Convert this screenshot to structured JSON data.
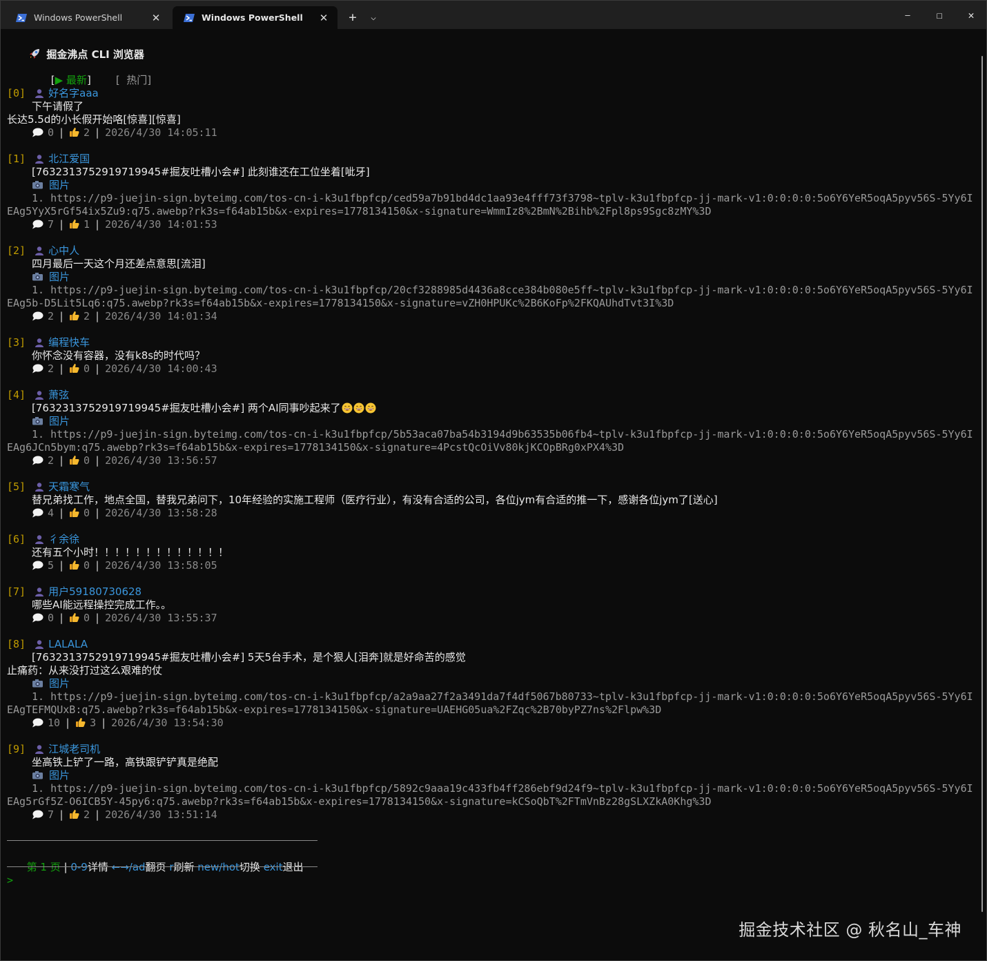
{
  "window": {
    "tabs": [
      {
        "label": "Windows PowerShell",
        "active": false
      },
      {
        "label": "Windows PowerShell",
        "active": true
      }
    ],
    "new_tab_glyph": "+",
    "dropdown_glyph": "⌵",
    "minimize_glyph": "—",
    "maximize_glyph": "☐",
    "close_glyph": "✕",
    "tab_close_glyph": "✕"
  },
  "app": {
    "title": "掘金沸点 CLI 浏览器",
    "tabs": {
      "latest_open": "[",
      "latest_arrow": "▶",
      "latest_label": "最新",
      "latest_close": "]",
      "hot_label": "[  热门]"
    }
  },
  "posts": [
    {
      "index": "[0]",
      "user": "好名字aaa",
      "content_lines": [
        {
          "text": "下午请假了",
          "indent": true
        },
        {
          "text": "长达5.5d的小长假开始咯[惊喜][惊喜]",
          "indent": false
        }
      ],
      "image_label": "",
      "url_lines": [],
      "comments": "0",
      "likes": "2",
      "time": "2026/4/30 14:05:11"
    },
    {
      "index": "[1]",
      "user": "北江爱国",
      "content_lines": [
        {
          "text": "[7632313752919719945#掘友吐槽小会#] 此刻谁还在工位坐着[呲牙]",
          "indent": true
        }
      ],
      "image_label": "图片",
      "url_lines": [
        "1. https://p9-juejin-sign.byteimg.com/tos-cn-i-k3u1fbpfcp/ced59a7b91bd4dc1aa93e4fff73f3798~tplv-k3u1fbpfcp-jj-mark-v1:0:0:0:0:5o6Y6YeR5oqA5pyv56S-5Yy6I",
        "EAg5YyX5rGf54ix5Zu9:q75.awebp?rk3s=f64ab15b&x-expires=1778134150&x-signature=WmmIz8%2BmN%2Bihb%2Fpl8ps9Sgc8zMY%3D"
      ],
      "comments": "7",
      "likes": "1",
      "time": "2026/4/30 14:01:53"
    },
    {
      "index": "[2]",
      "user": "心中人",
      "content_lines": [
        {
          "text": "四月最后一天这个月还差点意思[流泪]",
          "indent": true
        }
      ],
      "image_label": "图片",
      "url_lines": [
        "1. https://p9-juejin-sign.byteimg.com/tos-cn-i-k3u1fbpfcp/20cf3288985d4436a8cce384b080e5ff~tplv-k3u1fbpfcp-jj-mark-v1:0:0:0:0:5o6Y6YeR5oqA5pyv56S-5Yy6I",
        "EAg5b-D5Lit5Lq6:q75.awebp?rk3s=f64ab15b&x-expires=1778134150&x-signature=vZH0HPUKc%2B6KoFp%2FKQAUhdTvt3I%3D"
      ],
      "comments": "2",
      "likes": "2",
      "time": "2026/4/30 14:01:34"
    },
    {
      "index": "[3]",
      "user": "编程快车",
      "content_lines": [
        {
          "text": "你怀念没有容器，没有k8s的时代吗？",
          "indent": true
        }
      ],
      "image_label": "",
      "url_lines": [],
      "comments": "2",
      "likes": "0",
      "time": "2026/4/30 14:00:43"
    },
    {
      "index": "[4]",
      "user": "萧弦",
      "content_lines": [
        {
          "text": "[7632313752919719945#掘友吐槽小会#] 两个AI同事吵起来了",
          "indent": true,
          "grins": 3
        }
      ],
      "image_label": "图片",
      "url_lines": [
        "1. https://p9-juejin-sign.byteimg.com/tos-cn-i-k3u1fbpfcp/5b53aca07ba54b3194d9b63535b06fb4~tplv-k3u1fbpfcp-jj-mark-v1:0:0:0:0:5o6Y6YeR5oqA5pyv56S-5Yy6I",
        "EAg6JCn5bym:q75.awebp?rk3s=f64ab15b&x-expires=1778134150&x-signature=4PcstQcOiVv80kjKCOpBRg0xPX4%3D"
      ],
      "comments": "2",
      "likes": "0",
      "time": "2026/4/30 13:56:57"
    },
    {
      "index": "[5]",
      "user": "天霜寒气",
      "content_lines": [
        {
          "text": "替兄弟找工作，地点全国，替我兄弟问下，10年经验的实施工程师（医疗行业），有没有合适的公司，各位jym有合适的推一下，感谢各位jym了[送心]",
          "indent": true
        }
      ],
      "image_label": "",
      "url_lines": [],
      "comments": "4",
      "likes": "0",
      "time": "2026/4/30 13:58:28"
    },
    {
      "index": "[6]",
      "user": "彳余徐",
      "content_lines": [
        {
          "text": "还有五个小时！！！！！！！！！！！！！",
          "indent": true
        }
      ],
      "image_label": "",
      "url_lines": [],
      "comments": "5",
      "likes": "0",
      "time": "2026/4/30 13:58:05"
    },
    {
      "index": "[7]",
      "user": "用户59180730628",
      "content_lines": [
        {
          "text": "哪些AI能远程操控完成工作。。",
          "indent": true
        }
      ],
      "image_label": "",
      "url_lines": [],
      "comments": "0",
      "likes": "0",
      "time": "2026/4/30 13:55:37"
    },
    {
      "index": "[8]",
      "user": "LALALA",
      "content_lines": [
        {
          "text": "[7632313752919719945#掘友吐槽小会#] 5天5台手术，是个狠人[泪奔]就是好命苦的感觉",
          "indent": true
        },
        {
          "text": "止痛药：从来没打过这么艰难的仗",
          "indent": false
        }
      ],
      "image_label": "图片",
      "url_lines": [
        "1. https://p9-juejin-sign.byteimg.com/tos-cn-i-k3u1fbpfcp/a2a9aa27f2a3491da7f4df5067b80733~tplv-k3u1fbpfcp-jj-mark-v1:0:0:0:0:5o6Y6YeR5oqA5pyv56S-5Yy6I",
        "EAgTEFMQUxB:q75.awebp?rk3s=f64ab15b&x-expires=1778134150&x-signature=UAEHG05ua%2FZqc%2B70byPZ7ns%2Flpw%3D"
      ],
      "comments": "10",
      "likes": "3",
      "time": "2026/4/30 13:54:30"
    },
    {
      "index": "[9]",
      "user": "江城老司机",
      "content_lines": [
        {
          "text": "坐高铁上铲了一路，高铁跟铲铲真是绝配",
          "indent": true
        }
      ],
      "image_label": "图片",
      "url_lines": [
        "1. https://p9-juejin-sign.byteimg.com/tos-cn-i-k3u1fbpfcp/5892c9aaa19c433fb4ff286ebf9d24f9~tplv-k3u1fbpfcp-jj-mark-v1:0:0:0:0:5o6Y6YeR5oqA5pyv56S-5Yy6I",
        "EAg5rGf5Z-O6ICB5Y-45py6:q75.awebp?rk3s=f64ab15b&x-expires=1778134150&x-signature=kCSoQbT%2FTmVnBz28gSLXZkA0Khg%3D"
      ],
      "comments": "7",
      "likes": "2",
      "time": "2026/4/30 13:51:14"
    }
  ],
  "footer": {
    "page_label": "第 1 页",
    "divider": "|",
    "keys": [
      {
        "key": "0-9",
        "desc": "详情"
      },
      {
        "key": "←→/ad",
        "desc": "翻页"
      },
      {
        "key": "r",
        "desc": "刷新"
      },
      {
        "key": "new/hot",
        "desc": "切换"
      },
      {
        "key": "exit",
        "desc": "退出"
      }
    ],
    "prompt": ">"
  },
  "watermark": "掘金技术社区 @ 秋名山_车神",
  "colors": {
    "background": "#0c0c0c",
    "tabbar": "#202020",
    "index": "#c19c00",
    "username": "#3a96dd",
    "active_tab": "#13a10e",
    "url": "#9a9a9a"
  },
  "icons": {
    "tab": "powershell-icon",
    "title": "rocket-icon",
    "user": "user-icon",
    "comment": "speech-bubble-icon",
    "like": "thumbs-up-icon",
    "image": "camera-icon",
    "emoji": "grinning-face-icon"
  }
}
